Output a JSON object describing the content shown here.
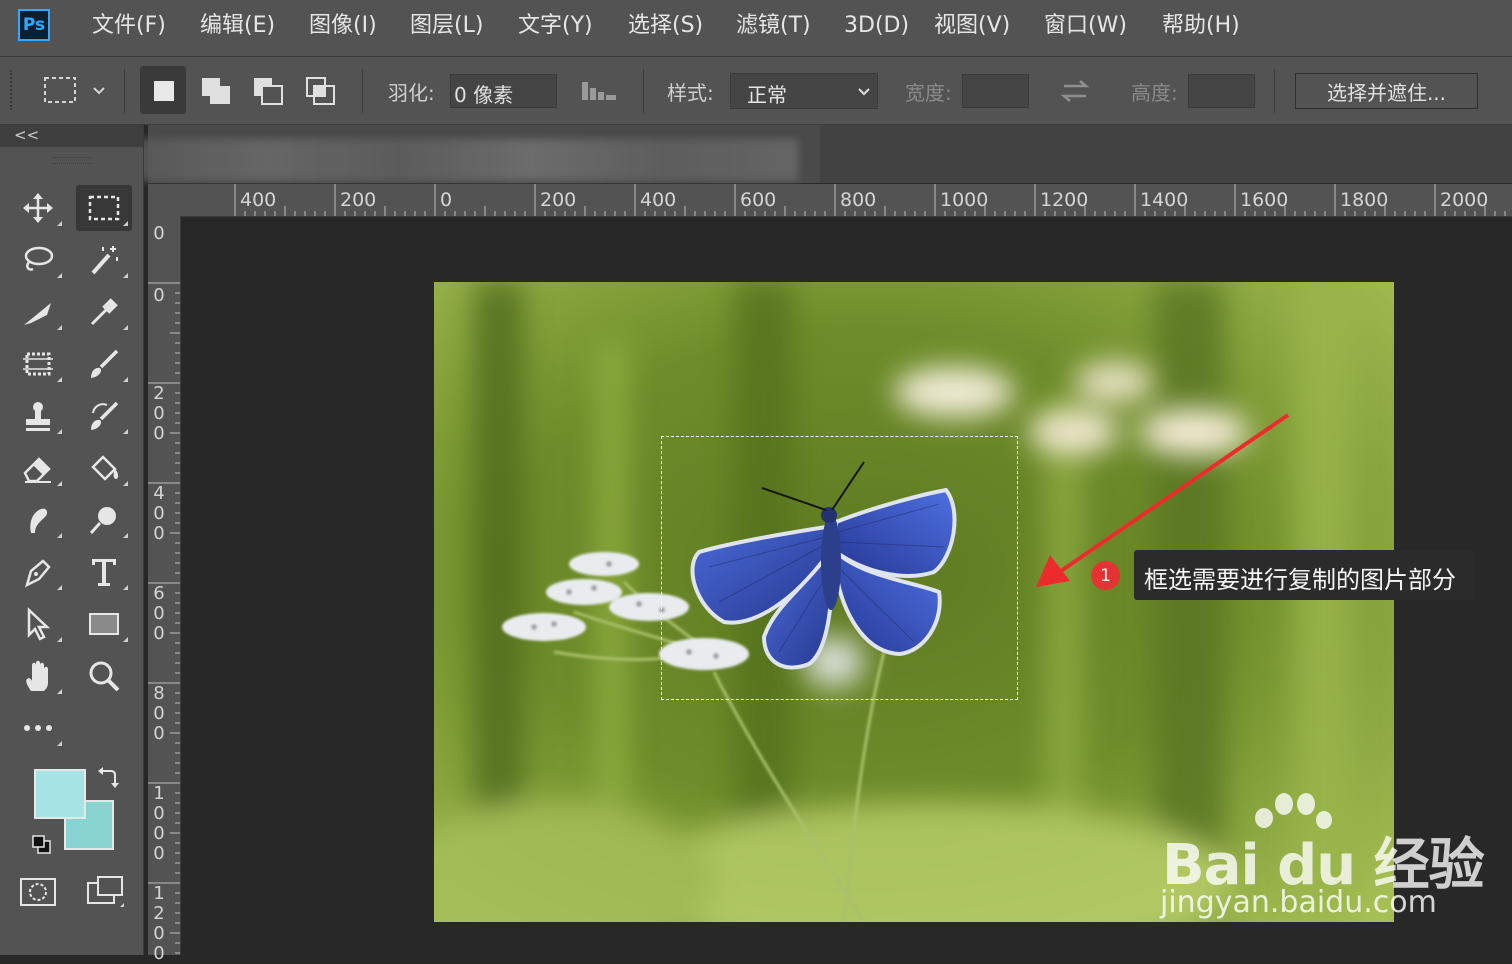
{
  "app": {
    "logo": "Ps"
  },
  "menu": [
    "文件(F)",
    "编辑(E)",
    "图像(I)",
    "图层(L)",
    "文字(Y)",
    "选择(S)",
    "滤镜(T)",
    "3D(D)",
    "视图(V)",
    "窗口(W)",
    "帮助(H)"
  ],
  "options": {
    "feather_label": "羽化:",
    "feather_value": "0 像素",
    "style_label": "样式:",
    "style_value": "正常",
    "width_label": "宽度:",
    "height_label": "高度:",
    "refine_button": "选择并遮住..."
  },
  "panel": {
    "collapse": "<<"
  },
  "ruler": {
    "horizontal": [
      "400",
      "200",
      "0",
      "200",
      "400",
      "600",
      "800",
      "1000",
      "1200",
      "1400",
      "1600",
      "1800",
      "2000"
    ],
    "vertical": [
      "0",
      "0",
      "200",
      "400",
      "600",
      "800",
      "1000",
      "1200"
    ]
  },
  "tools": [
    {
      "name": "move-tool"
    },
    {
      "name": "rectangular-marquee-tool",
      "active": true
    },
    {
      "name": "lasso-tool"
    },
    {
      "name": "magic-wand-tool"
    },
    {
      "name": "slice-tool"
    },
    {
      "name": "eyedropper-tool"
    },
    {
      "name": "crop-frame-tool"
    },
    {
      "name": "brush-tool"
    },
    {
      "name": "clone-stamp-tool"
    },
    {
      "name": "history-brush-tool"
    },
    {
      "name": "eraser-tool"
    },
    {
      "name": "paint-bucket-tool"
    },
    {
      "name": "smudge-tool"
    },
    {
      "name": "dodge-tool"
    },
    {
      "name": "pen-tool"
    },
    {
      "name": "type-tool"
    },
    {
      "name": "path-selection-tool"
    },
    {
      "name": "rectangle-tool"
    },
    {
      "name": "hand-tool"
    },
    {
      "name": "zoom-tool"
    },
    {
      "name": "more-tools"
    }
  ],
  "colors": {
    "foreground": "#a6e3e5",
    "background": "#86d3d0",
    "accent": "#31a8ff",
    "badge": "#e63232"
  },
  "annotation": {
    "badge": "1",
    "text": "框选需要进行复制的图片部分"
  },
  "watermark": {
    "brand": "Bai du 经验",
    "url": "jingyan.baidu.com"
  }
}
